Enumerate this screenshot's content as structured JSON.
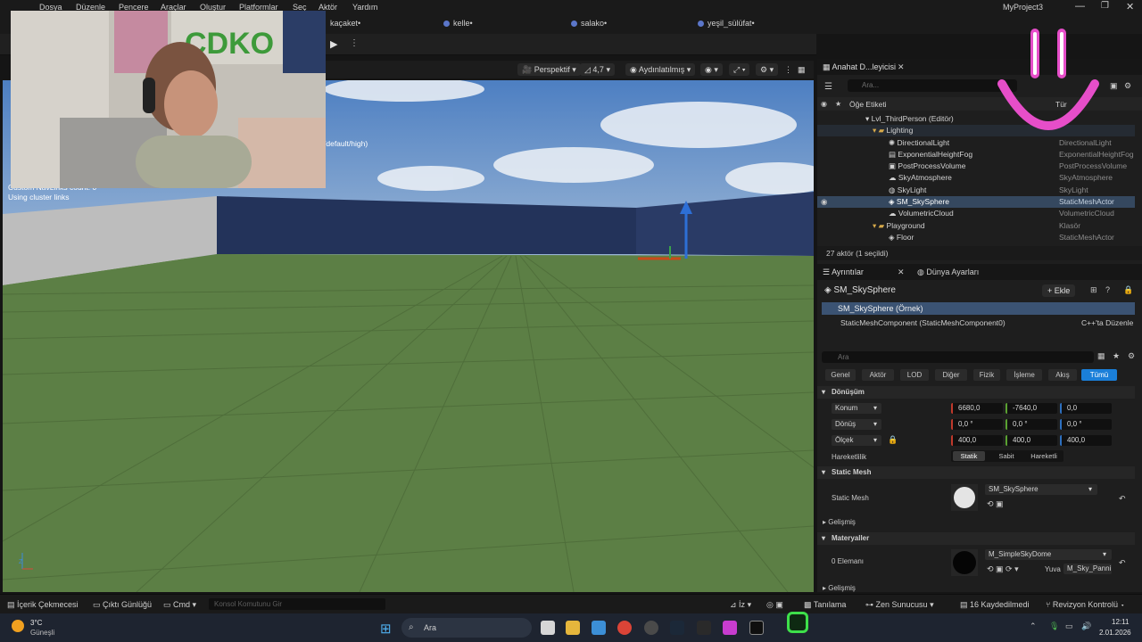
{
  "menu": [
    "Dosya",
    "Düzenle",
    "Pencere",
    "Araçlar",
    "Oluştur",
    "Platformlar",
    "Seç",
    "Aktör",
    "Yardım"
  ],
  "project_title": "MyProject3",
  "collab_users": [
    "kaçaket•",
    "kelle•",
    "salako•",
    "yeşil_sülüfat•"
  ],
  "viewport": {
    "view_mode": "Perspektif",
    "fov": "4,7",
    "lighting": "Aydınlatılmış",
    "overlay_text": [
      "/default/high)",
      "Custom NavLinks count: 0",
      "Using cluster links"
    ]
  },
  "outliner": {
    "tab_title": "Anahat D...leyicisi",
    "search_placeholder": "Ara...",
    "col_label": "Öğe Etiketi",
    "col_type": "Tür",
    "rows": [
      {
        "name": "Lvl_ThirdPerson (Editör)",
        "type": ""
      },
      {
        "name": "Lighting",
        "type": ""
      },
      {
        "name": "DirectionalLight",
        "type": "DirectionalLight"
      },
      {
        "name": "ExponentialHeightFog",
        "type": "ExponentialHeightFog"
      },
      {
        "name": "PostProcessVolume",
        "type": "PostProcessVolume"
      },
      {
        "name": "SkyAtmosphere",
        "type": "SkyAtmosphere"
      },
      {
        "name": "SkyLight",
        "type": "SkyLight"
      },
      {
        "name": "SM_SkySphere",
        "type": "StaticMeshActor"
      },
      {
        "name": "VolumetricCloud",
        "type": "VolumetricCloud"
      },
      {
        "name": "Playground",
        "type": "Klasör"
      },
      {
        "name": "Floor",
        "type": "StaticMeshActor"
      }
    ],
    "status": "27 aktör (1 seçildi)"
  },
  "details": {
    "tab_details": "Ayrıntılar",
    "tab_world": "Dünya Ayarları",
    "actor_name": "SM_SkySphere",
    "add_label": "+ Ekle",
    "instance_label": "SM_SkySphere (Örnek)",
    "component_label": "StaticMeshComponent (StaticMeshComponent0)",
    "cpp_edit": "C++'ta Düzenle",
    "search_placeholder": "Ara",
    "categories": [
      "Genel",
      "Aktör",
      "LOD",
      "Diğer",
      "Fizik",
      "İşleme",
      "Akış",
      "Tümü"
    ],
    "transform_section": "Dönüşüm",
    "location_label": "Konum",
    "location": [
      "6680,0",
      "-7640,0",
      "0,0"
    ],
    "rotation_label": "Dönüş",
    "rotation": [
      "0,0 °",
      "0,0 °",
      "0,0 °"
    ],
    "scale_label": "Ölçek",
    "scale": [
      "400,0",
      "400,0",
      "400,0"
    ],
    "mobility_label": "Hareketlilik",
    "mobility": [
      "Statik",
      "Sabit",
      "Hareketli"
    ],
    "static_mesh_section": "Static Mesh",
    "static_mesh_label": "Static Mesh",
    "static_mesh_value": "SM_SkySphere",
    "advanced_label": "Gelişmiş",
    "materials_section": "Materyaller",
    "elements_label": "0 Elemanı",
    "material_value": "M_SimpleSkyDome",
    "yuva_label": "Yuva",
    "yuva_value": "M_Sky_Panni",
    "advanced_label2": "Gelişmiş"
  },
  "statusbar": {
    "content_drawer": "İçerik Çekmecesi",
    "output_log": "Çıktı Günlüğü",
    "cmd": "Cmd",
    "console_placeholder": "Konsol Komutunu Gir",
    "trace": "İz",
    "diagnostics": "Tanılama",
    "zen": "Zen Sunucusu",
    "unsaved": "16 Kaydedilmedi",
    "revision": "Revizyon Kontrolü"
  },
  "taskbar": {
    "weather_temp": "3°C",
    "weather_desc": "Güneşli",
    "search": "Ara",
    "time": "12:11",
    "date": "2.01.2026"
  },
  "colors": {
    "selection": "#35485f",
    "accent": "#1a7fd9",
    "ground": "#5c7f45"
  }
}
